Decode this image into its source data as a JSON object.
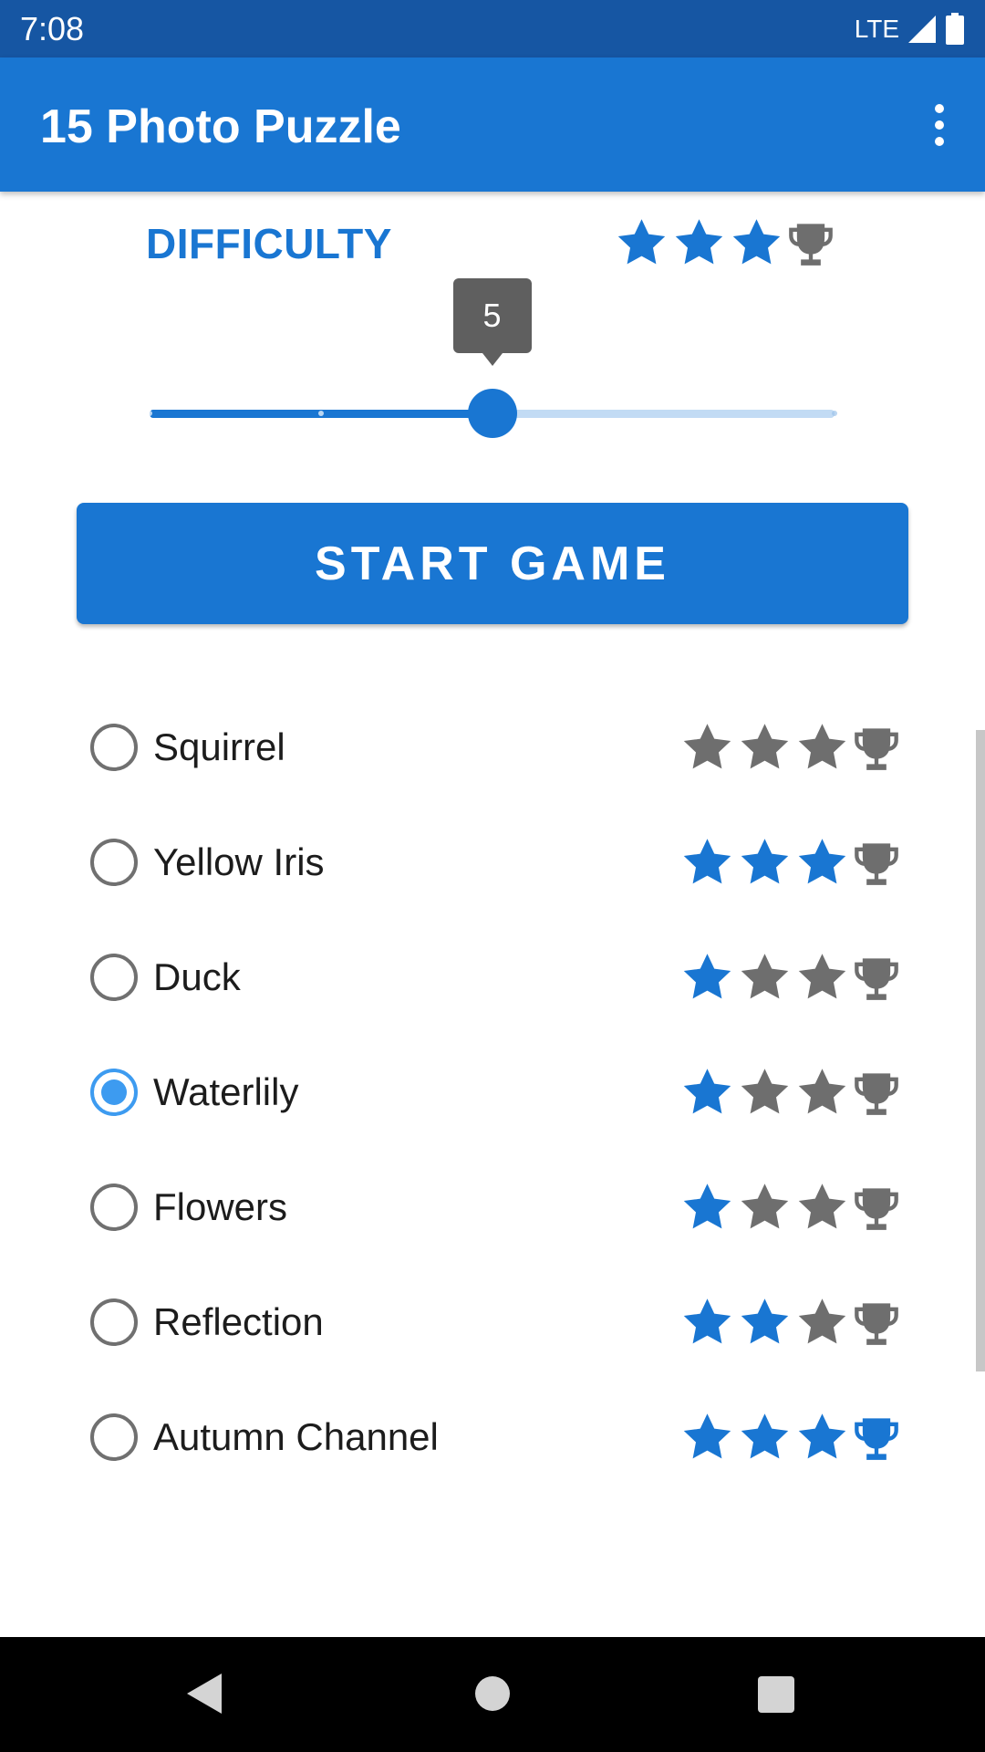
{
  "status_bar": {
    "time": "7:08",
    "network": "LTE",
    "signal_icon": "signal-icon",
    "battery_icon": "battery-icon"
  },
  "app_bar": {
    "title": "15 Photo Puzzle",
    "overflow_icon": "more-vert-icon"
  },
  "difficulty": {
    "label": "DIFFICULTY",
    "rating": {
      "stars_filled": 3,
      "stars_total": 3,
      "trophy_earned": false
    },
    "slider": {
      "min": 1,
      "max": 9,
      "value": 5,
      "value_label": "5",
      "tick_values": [
        1,
        3,
        9
      ]
    }
  },
  "start_button": {
    "label": "START GAME"
  },
  "puzzles": [
    {
      "name": "Squirrel",
      "selected": false,
      "stars": 0,
      "trophy": false
    },
    {
      "name": "Yellow Iris",
      "selected": false,
      "stars": 3,
      "trophy": false
    },
    {
      "name": "Duck",
      "selected": false,
      "stars": 1,
      "trophy": false
    },
    {
      "name": "Waterlily",
      "selected": true,
      "stars": 1,
      "trophy": false
    },
    {
      "name": "Flowers",
      "selected": false,
      "stars": 1,
      "trophy": false
    },
    {
      "name": "Reflection",
      "selected": false,
      "stars": 2,
      "trophy": false
    },
    {
      "name": "Autumn Channel",
      "selected": false,
      "stars": 3,
      "trophy": true
    }
  ],
  "colors": {
    "status_bar": "#1656a3",
    "app_bar": "#1976d2",
    "accent": "#1976d2",
    "radio_checked": "#3d9bf0",
    "star_filled": "#1976d2",
    "star_empty": "#6e6e6e",
    "slider_track_inactive": "#c2dbf4",
    "slider_bubble": "#5f5f5f",
    "nav_bar": "#000000"
  },
  "nav_bar": {
    "back_icon": "back-triangle-icon",
    "home_icon": "home-circle-icon",
    "recents_icon": "recents-square-icon"
  }
}
